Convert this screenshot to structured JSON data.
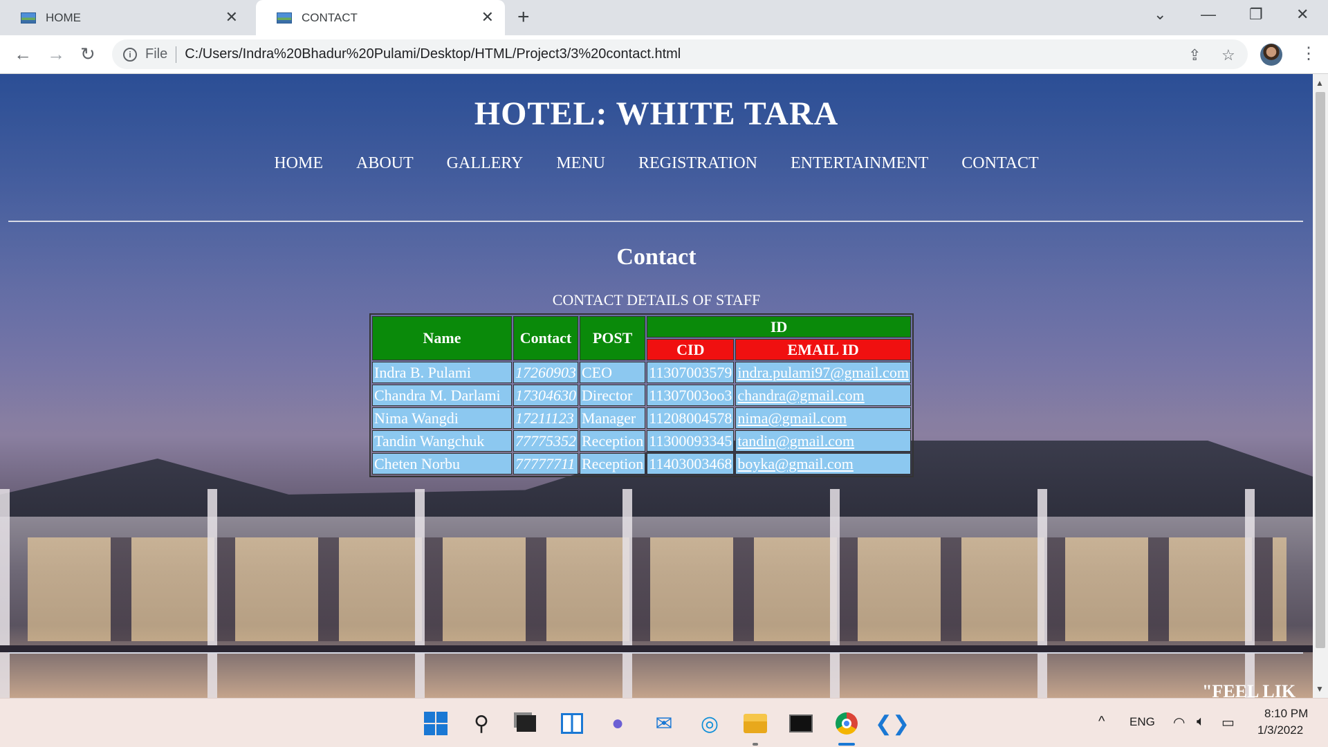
{
  "browser": {
    "tabs": [
      {
        "title": "HOME"
      },
      {
        "title": "CONTACT"
      }
    ],
    "scheme": "File",
    "url": "C:/Users/Indra%20Bhadur%20Pulami/Desktop/HTML/Project3/3%20contact.html"
  },
  "page": {
    "site_title": "HOTEL: WHITE TARA",
    "nav": [
      "HOME",
      "ABOUT",
      "GALLERY",
      "MENU",
      "REGISTRATION",
      "ENTERTAINMENT",
      "CONTACT"
    ],
    "heading": "Contact",
    "caption": "CONTACT DETAILS OF STAFF",
    "table": {
      "headers": {
        "name": "Name",
        "contact": "Contact",
        "post": "POST",
        "id": "ID",
        "cid": "CID",
        "email": "EMAIL ID"
      },
      "rows": [
        {
          "name": "Indra B. Pulami",
          "contact": "17260903",
          "post": "CEO",
          "cid": "11307003579",
          "email": "indra.pulami97@gmail.com"
        },
        {
          "name": "Chandra M. Darlami",
          "contact": "17304630",
          "post": "Director",
          "cid": "11307003oo3",
          "email": "chandra@gmail.com"
        },
        {
          "name": "Nima Wangdi",
          "contact": "17211123",
          "post": "Manager",
          "cid": "11208004578",
          "email": "nima@gmail.com"
        },
        {
          "name": "Tandin Wangchuk",
          "contact": "77775352",
          "post": "Reception",
          "cid": "11300093345",
          "email": "tandin@gmail.com"
        },
        {
          "name": "Cheten Norbu",
          "contact": "77777711",
          "post": "Reception",
          "cid": "11403003468",
          "email": "boyka@gmail.com"
        }
      ],
      "colors": {
        "header_green": "#0a8a0a",
        "header_red": "#f01010",
        "cell_blue": "#8cc8f0"
      }
    },
    "footer_quote": "\"FEEL LIK"
  },
  "taskbar": {
    "language": "ENG",
    "time": "8:10 PM",
    "date": "1/3/2022",
    "apps": [
      "start-icon",
      "search-icon",
      "task-view-icon",
      "widgets-icon",
      "teams-chat-icon",
      "mail-icon",
      "edge-icon",
      "file-explorer-icon",
      "terminal-icon",
      "chrome-icon",
      "vscode-icon"
    ]
  }
}
